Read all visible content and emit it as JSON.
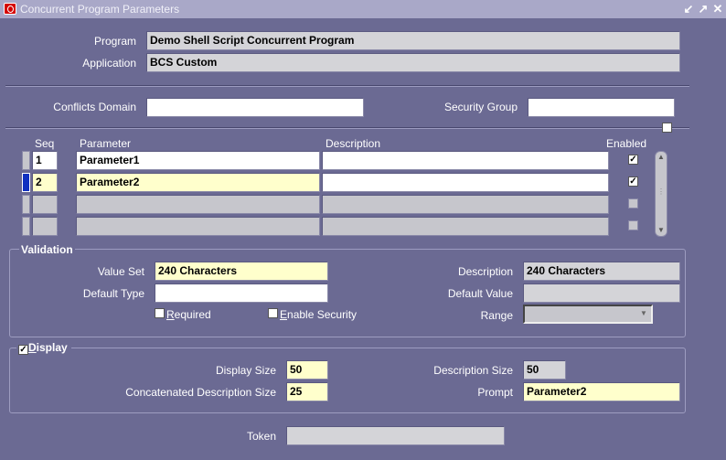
{
  "window": {
    "title": "Concurrent Program Parameters",
    "controls": [
      "minimize-icon",
      "maximize-icon",
      "close-icon"
    ]
  },
  "header": {
    "program_label": "Program",
    "program_value": "Demo Shell Script  Concurrent Program",
    "application_label": "Application",
    "application_value": "BCS Custom"
  },
  "filters": {
    "conflicts_domain_label": "Conflicts Domain",
    "conflicts_domain_value": "",
    "security_group_label": "Security Group",
    "security_group_value": ""
  },
  "table": {
    "columns": {
      "seq": "Seq",
      "parameter": "Parameter",
      "description": "Description",
      "enabled": "Enabled"
    },
    "rows": [
      {
        "seq": "1",
        "parameter": "Parameter1",
        "description": "",
        "enabled": true
      },
      {
        "seq": "2",
        "parameter": "Parameter2",
        "description": "",
        "enabled": true,
        "current": true
      },
      {
        "seq": "",
        "parameter": "",
        "description": "",
        "enabled": false
      },
      {
        "seq": "",
        "parameter": "",
        "description": "",
        "enabled": false
      }
    ]
  },
  "validation": {
    "group_label": "Validation",
    "value_set_label": "Value Set",
    "value_set_value": "240 Characters",
    "description_label": "Description",
    "description_value": "240 Characters",
    "default_type_label": "Default Type",
    "default_type_value": "",
    "default_value_label": "Default Value",
    "default_value_value": "",
    "required_label_pre": "",
    "required_label_key": "R",
    "required_label_post": "equired",
    "required_checked": false,
    "enable_security_pre": "",
    "enable_security_key": "E",
    "enable_security_post": "nable Security",
    "enable_security_checked": false,
    "range_label": "Range",
    "range_value": ""
  },
  "display": {
    "group_key": "D",
    "group_rest": "isplay",
    "checked": true,
    "display_size_label": "Display Size",
    "display_size_value": "50",
    "description_size_label": "Description Size",
    "description_size_value": "50",
    "concat_desc_size_label": "Concatenated Description Size",
    "concat_desc_size_value": "25",
    "prompt_label": "Prompt",
    "prompt_value": "Parameter2"
  },
  "token": {
    "label": "Token",
    "value": ""
  },
  "colors": {
    "background": "#6b6a93",
    "titlebar": "#a9a8c8",
    "current_row": "#1030c0",
    "required_field": "#ffffcc"
  }
}
